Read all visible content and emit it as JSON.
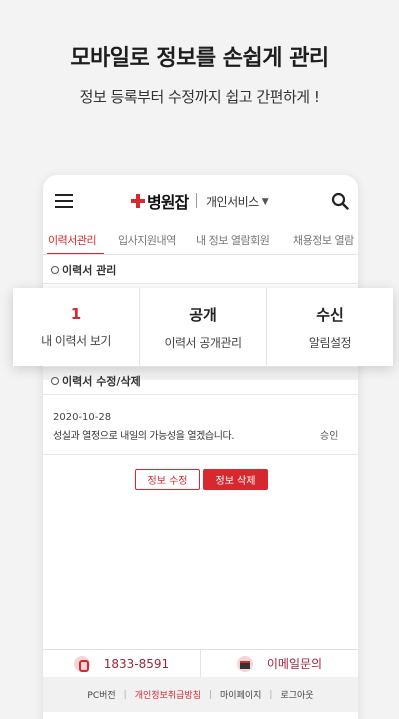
{
  "promo": {
    "title": "모바일로 정보를 손쉽게 관리",
    "subtitle": "정보 등록부터 수정까지 쉽고 간편하게 !"
  },
  "header": {
    "logo": "병원잡",
    "service_menu": "개인서비스",
    "service_menu_caret": "▼"
  },
  "tabs": [
    {
      "label": "이력서관리",
      "active": true
    },
    {
      "label": "입사지원내역"
    },
    {
      "label": "내 정보 열람회원"
    },
    {
      "label": "채용정보 열람"
    }
  ],
  "sections": {
    "resume_manage": "이력서 관리",
    "resume_edit": "이력서 수정/삭제"
  },
  "cards": [
    {
      "value": "1",
      "label": "내 이력서 보기"
    },
    {
      "value": "공개",
      "label": "이력서 공개관리"
    },
    {
      "value": "수신",
      "label": "알림설정"
    }
  ],
  "resume_item": {
    "date": "2020-10-28",
    "title": "성실과 열정으로 내일의 가능성을 열겠습니다.",
    "status": "승인"
  },
  "buttons": {
    "edit": "정보 수정",
    "delete": "정보 삭제"
  },
  "contact": {
    "phone": "1833-8591",
    "email": "이메일문의"
  },
  "footer": {
    "pc": "PC버전",
    "privacy": "개인정보취급방침",
    "mypage": "마이페이지",
    "logout": "로그아웃"
  },
  "colors": {
    "accent": "#d7282f",
    "background": "#f3f3f4"
  }
}
